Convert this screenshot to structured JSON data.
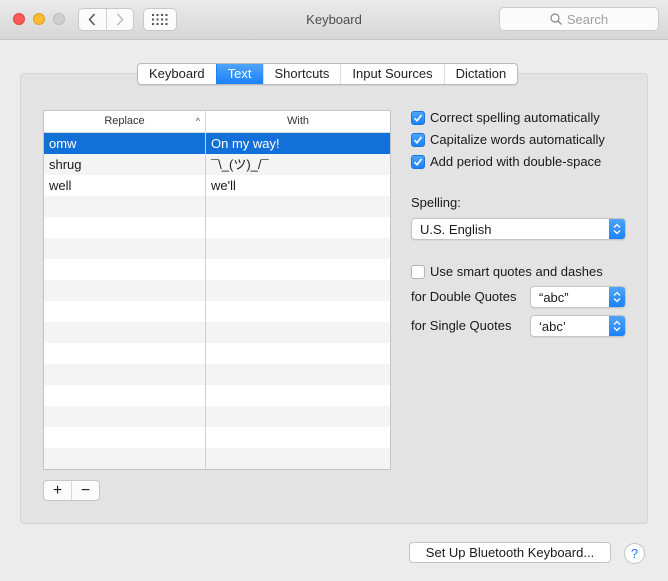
{
  "window": {
    "title": "Keyboard",
    "search_placeholder": "Search"
  },
  "tabs": [
    {
      "label": "Keyboard",
      "active": false
    },
    {
      "label": "Text",
      "active": true
    },
    {
      "label": "Shortcuts",
      "active": false
    },
    {
      "label": "Input Sources",
      "active": false
    },
    {
      "label": "Dictation",
      "active": false
    }
  ],
  "table": {
    "columns": {
      "replace": "Replace",
      "with": "With"
    },
    "sort_indicator": "^",
    "rows": [
      {
        "replace": "omw",
        "with": "On my way!",
        "selected": true
      },
      {
        "replace": "shrug",
        "with": "¯\\_(ツ)_/¯",
        "selected": false
      },
      {
        "replace": "well",
        "with": "we'll",
        "selected": false
      }
    ],
    "add_label": "+",
    "remove_label": "−"
  },
  "options": {
    "correct_spelling": {
      "label": "Correct spelling automatically",
      "checked": true
    },
    "capitalize_words": {
      "label": "Capitalize words automatically",
      "checked": true
    },
    "add_period": {
      "label": "Add period with double-space",
      "checked": true
    },
    "spelling_label": "Spelling:",
    "spelling_value": "U.S. English",
    "smart_quotes": {
      "label": "Use smart quotes and dashes",
      "checked": false
    },
    "double_quotes_label": "for Double Quotes",
    "double_quotes_value": "“abc”",
    "single_quotes_label": "for Single Quotes",
    "single_quotes_value": "‘abc’"
  },
  "footer": {
    "bluetooth_button": "Set Up Bluetooth Keyboard...",
    "help_label": "?"
  },
  "colors": {
    "accent": "#1a82f9",
    "selection": "#1270d9"
  }
}
